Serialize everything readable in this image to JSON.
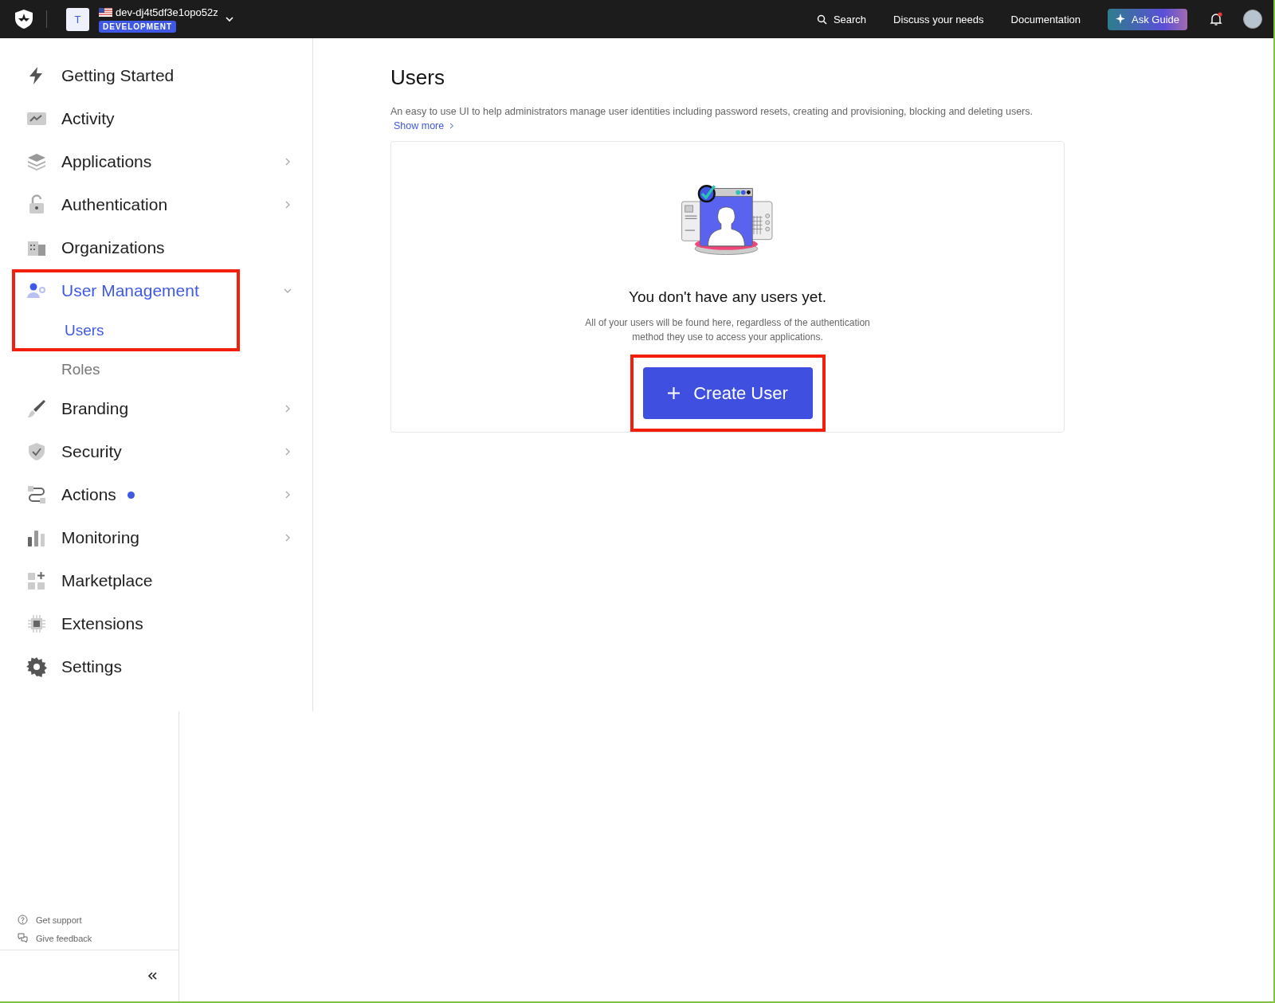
{
  "topbar": {
    "tenant_initial": "T",
    "tenant_name": "dev-dj4t5df3e1opo52z",
    "environment_badge": "DEVELOPMENT",
    "search": "Search",
    "links": [
      "Discuss your needs",
      "Documentation"
    ],
    "ask_button": "Ask Guide",
    "unread_notifications": true
  },
  "sidebar": {
    "items": [
      {
        "label": "Getting Started",
        "kind": "link",
        "selected": false,
        "highlighted": false
      },
      {
        "label": "Activity",
        "kind": "link",
        "selected": false,
        "highlighted": false
      },
      {
        "label": "Applications",
        "kind": "group",
        "expanded": false,
        "selected": false,
        "highlighted": false
      },
      {
        "label": "Authentication",
        "kind": "group",
        "expanded": false,
        "selected": false,
        "highlighted": false
      },
      {
        "label": "Organizations",
        "kind": "link",
        "selected": false,
        "highlighted": false
      },
      {
        "label": "User Management",
        "kind": "group",
        "expanded": true,
        "selected": true,
        "highlighted": true,
        "children": [
          {
            "label": "Users",
            "selected": true,
            "highlighted": true
          },
          {
            "label": "Roles",
            "selected": false,
            "highlighted": false
          }
        ]
      },
      {
        "label": "Branding",
        "kind": "group",
        "expanded": false,
        "selected": false,
        "highlighted": false
      },
      {
        "label": "Security",
        "kind": "group",
        "expanded": false,
        "selected": false,
        "highlighted": false
      },
      {
        "label": "Actions",
        "kind": "group",
        "expanded": false,
        "selected": false,
        "highlighted": false,
        "new_dot": true
      },
      {
        "label": "Monitoring",
        "kind": "group",
        "expanded": false,
        "selected": false,
        "highlighted": false
      },
      {
        "label": "Marketplace",
        "kind": "link",
        "selected": false,
        "highlighted": false
      },
      {
        "label": "Extensions",
        "kind": "link",
        "selected": false,
        "highlighted": false
      },
      {
        "label": "Settings",
        "kind": "link",
        "selected": false,
        "highlighted": false
      }
    ],
    "footer_links": [
      "Get support",
      "Give feedback"
    ]
  },
  "page": {
    "title": "Users",
    "description": "An easy to use UI to help administrators manage user identities including password resets, creating and provisioning, blocking and deleting users.",
    "show_more": "Show more",
    "empty_state": {
      "heading": "You don't have any users yet.",
      "text": "All of your users will be found here, regardless of the authentication method they use to access your applications.",
      "button": "Create User",
      "highlighted": true
    }
  }
}
